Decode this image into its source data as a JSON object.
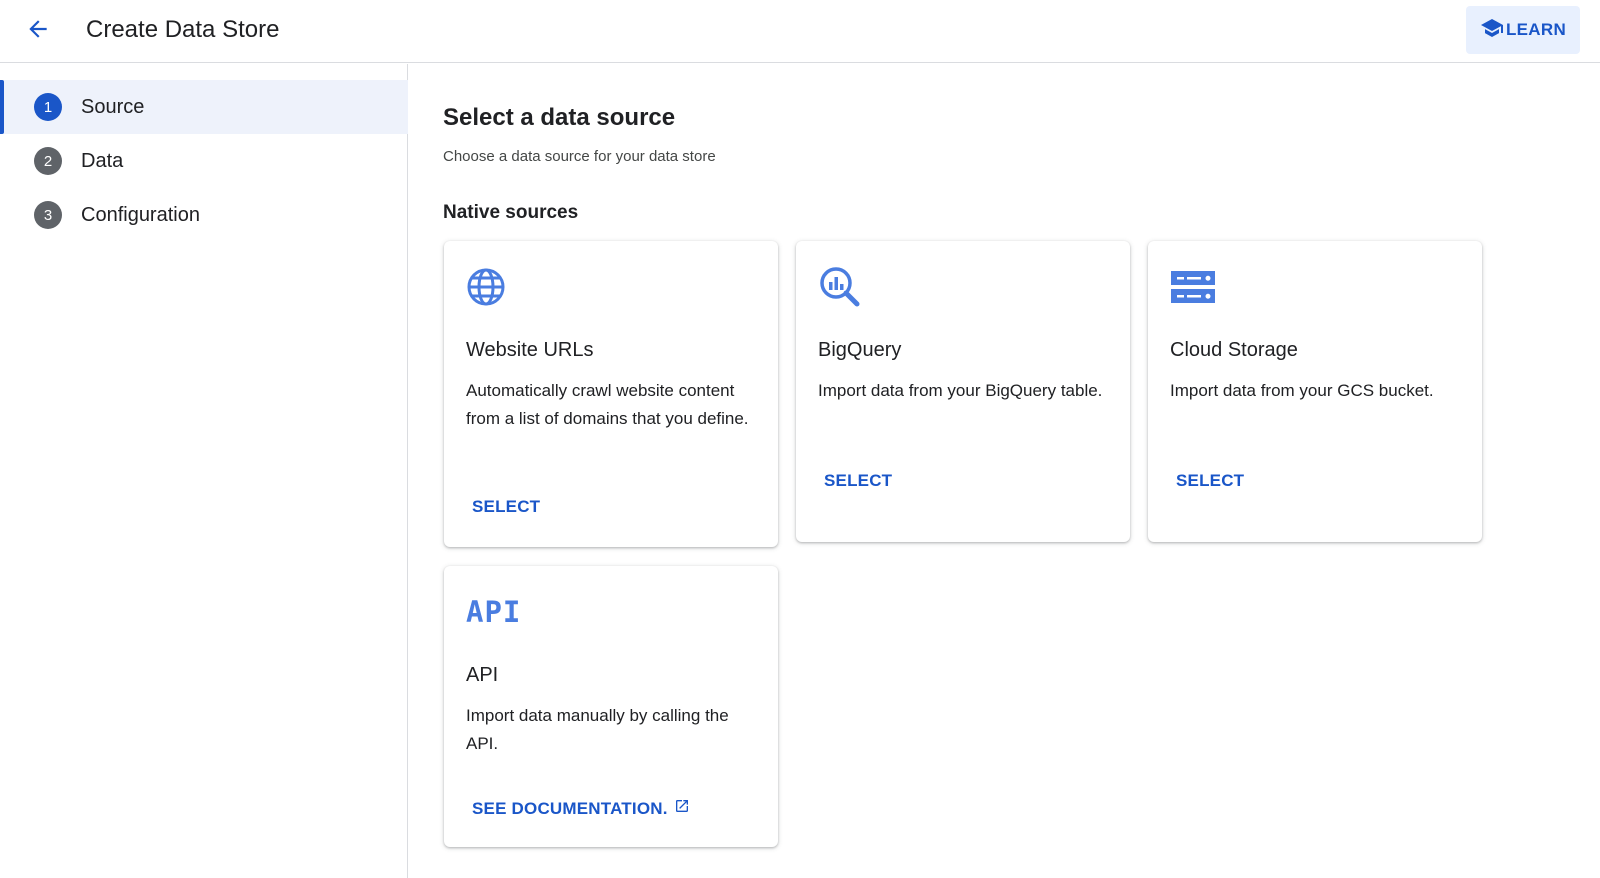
{
  "header": {
    "title": "Create Data Store",
    "learn_label": "LEARN"
  },
  "sidebar": {
    "steps": [
      {
        "number": "1",
        "label": "Source",
        "active": true
      },
      {
        "number": "2",
        "label": "Data",
        "active": false
      },
      {
        "number": "3",
        "label": "Configuration",
        "active": false
      }
    ]
  },
  "main": {
    "title": "Select a data source",
    "subtitle": "Choose a data source for your data store",
    "native_sources_title": "Native sources",
    "cards": [
      {
        "icon": "globe-icon",
        "title": "Website URLs",
        "description": "Automatically crawl website content from a list of domains that you define.",
        "action": "SELECT"
      },
      {
        "icon": "bigquery-icon",
        "title": "BigQuery",
        "description": "Import data from your BigQuery table.",
        "action": "SELECT"
      },
      {
        "icon": "cloud-storage-icon",
        "title": "Cloud Storage",
        "description": "Import data from your GCS bucket.",
        "action": "SELECT"
      },
      {
        "icon": "api-icon",
        "icon_text": "API",
        "title": "API",
        "description": "Import data manually by calling the API.",
        "action": "SEE DOCUMENTATION."
      }
    ]
  },
  "colors": {
    "accent": "#1a56c8",
    "icon_blue": "#4a7de0",
    "active_step_bg": "#eef2fb",
    "learn_bg": "#e8f0fe"
  }
}
